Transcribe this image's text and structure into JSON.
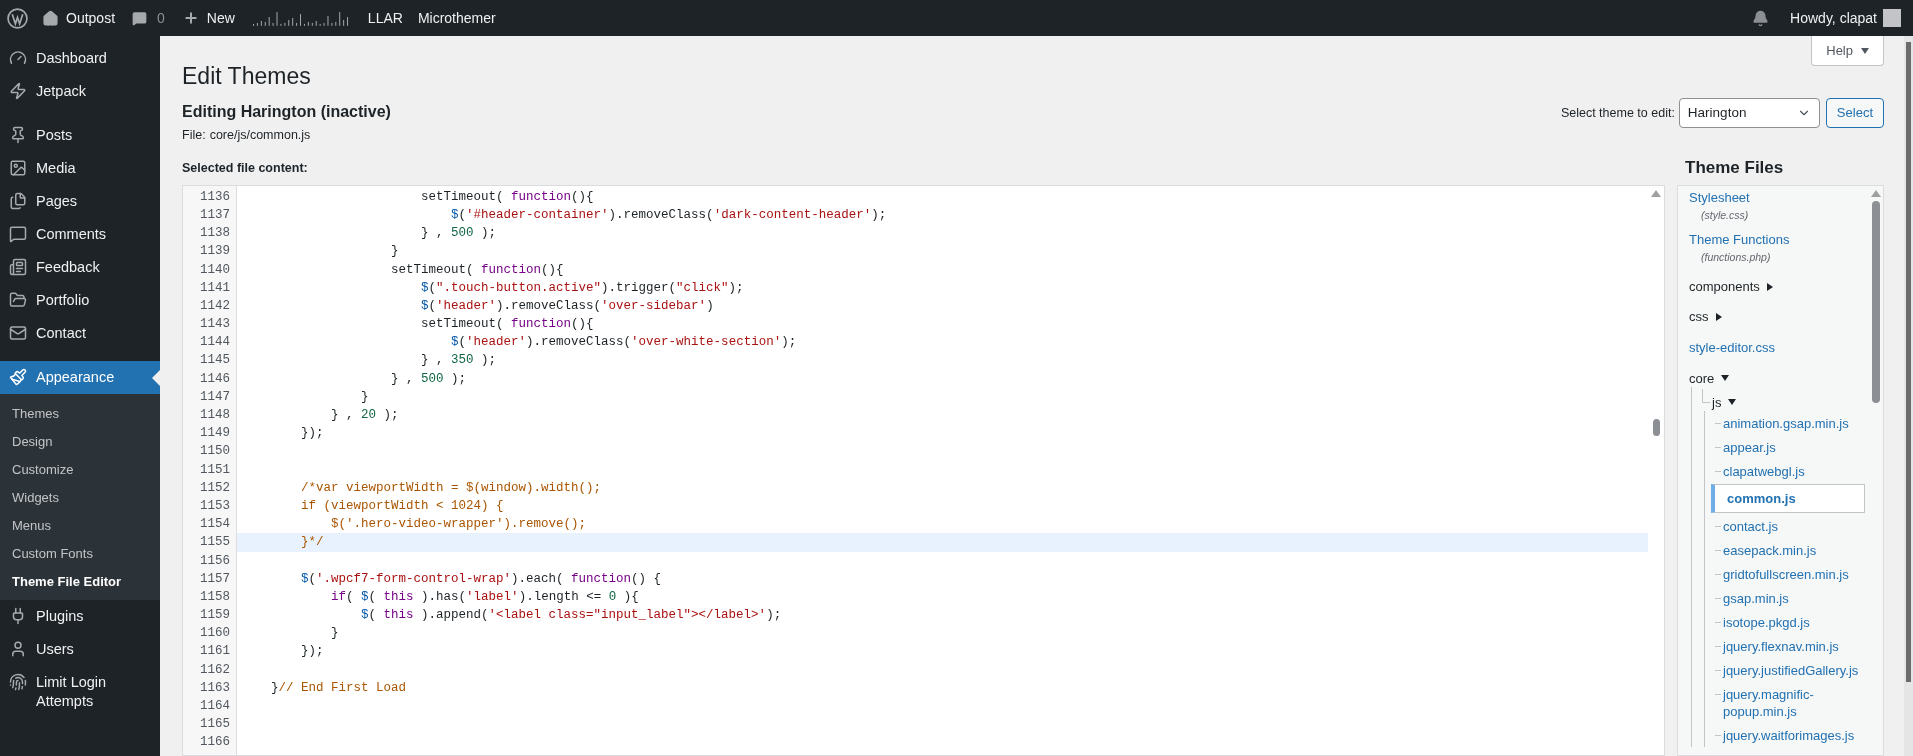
{
  "admin_bar": {
    "site": "Outpost",
    "comments": "0",
    "new": "New",
    "links": [
      "LLAR",
      "Microthemer"
    ],
    "greeting": "Howdy, clapat"
  },
  "sidebar": {
    "items": [
      {
        "label": "Dashboard",
        "selected": false
      },
      {
        "label": "Jetpack",
        "selected": false
      },
      {
        "label": "Posts",
        "selected": false
      },
      {
        "label": "Media",
        "selected": false
      },
      {
        "label": "Pages",
        "selected": false
      },
      {
        "label": "Comments",
        "selected": false
      },
      {
        "label": "Feedback",
        "selected": false
      },
      {
        "label": "Portfolio",
        "selected": false
      },
      {
        "label": "Contact",
        "selected": false
      },
      {
        "label": "Appearance",
        "selected": true,
        "children": [
          {
            "label": "Themes",
            "selected": false
          },
          {
            "label": "Design",
            "selected": false
          },
          {
            "label": "Customize",
            "selected": false
          },
          {
            "label": "Widgets",
            "selected": false
          },
          {
            "label": "Menus",
            "selected": false
          },
          {
            "label": "Custom Fonts",
            "selected": false
          },
          {
            "label": "Theme File Editor",
            "selected": true
          }
        ]
      },
      {
        "label": "Plugins",
        "selected": false
      },
      {
        "label": "Users",
        "selected": false
      },
      {
        "label": "Limit Login Attempts",
        "selected": false
      }
    ]
  },
  "help_button": "Help",
  "page": {
    "title": "Edit Themes",
    "subtitle": "Editing Harington (inactive)",
    "file_label": "File:",
    "file_path": "core/js/common.js",
    "content_label": "Selected file content:"
  },
  "theme_select": {
    "label": "Select theme to edit:",
    "value": "Harington",
    "button": "Select"
  },
  "editor": {
    "lines": [
      {
        "number": "1136",
        "highlighted": false,
        "segments": [
          {
            "kind": "plain",
            "text": "                        setTimeout( "
          },
          {
            "kind": "keyword",
            "text": "function"
          },
          {
            "kind": "plain",
            "text": "(){"
          }
        ]
      },
      {
        "number": "1137",
        "highlighted": false,
        "segments": [
          {
            "kind": "dollar",
            "text": "                            $"
          },
          {
            "kind": "plain",
            "text": "("
          },
          {
            "kind": "string",
            "text": "'#header-container'"
          },
          {
            "kind": "plain",
            "text": ").removeClass("
          },
          {
            "kind": "string",
            "text": "'dark-content-header'"
          },
          {
            "kind": "plain",
            "text": ");"
          }
        ]
      },
      {
        "number": "1138",
        "highlighted": false,
        "segments": [
          {
            "kind": "plain",
            "text": "                        } , "
          },
          {
            "kind": "number",
            "text": "500"
          },
          {
            "kind": "plain",
            "text": " );"
          }
        ]
      },
      {
        "number": "1139",
        "highlighted": false,
        "segments": [
          {
            "kind": "plain",
            "text": "                    }"
          }
        ]
      },
      {
        "number": "1140",
        "highlighted": false,
        "segments": [
          {
            "kind": "plain",
            "text": "                    setTimeout( "
          },
          {
            "kind": "keyword",
            "text": "function"
          },
          {
            "kind": "plain",
            "text": "(){"
          }
        ]
      },
      {
        "number": "1141",
        "highlighted": false,
        "segments": [
          {
            "kind": "dollar",
            "text": "                        $"
          },
          {
            "kind": "plain",
            "text": "("
          },
          {
            "kind": "string",
            "text": "\".touch-button.active\""
          },
          {
            "kind": "plain",
            "text": ").trigger("
          },
          {
            "kind": "string",
            "text": "\"click\""
          },
          {
            "kind": "plain",
            "text": ");"
          }
        ]
      },
      {
        "number": "1142",
        "highlighted": false,
        "segments": [
          {
            "kind": "dollar",
            "text": "                        $"
          },
          {
            "kind": "plain",
            "text": "("
          },
          {
            "kind": "string",
            "text": "'header'"
          },
          {
            "kind": "plain",
            "text": ").removeClass("
          },
          {
            "kind": "string",
            "text": "'over-sidebar'"
          },
          {
            "kind": "plain",
            "text": ")"
          }
        ]
      },
      {
        "number": "1143",
        "highlighted": false,
        "segments": [
          {
            "kind": "plain",
            "text": "                        setTimeout( "
          },
          {
            "kind": "keyword",
            "text": "function"
          },
          {
            "kind": "plain",
            "text": "(){"
          }
        ]
      },
      {
        "number": "1144",
        "highlighted": false,
        "segments": [
          {
            "kind": "dollar",
            "text": "                            $"
          },
          {
            "kind": "plain",
            "text": "("
          },
          {
            "kind": "string",
            "text": "'header'"
          },
          {
            "kind": "plain",
            "text": ").removeClass("
          },
          {
            "kind": "string",
            "text": "'over-white-section'"
          },
          {
            "kind": "plain",
            "text": ");"
          }
        ]
      },
      {
        "number": "1145",
        "highlighted": false,
        "segments": [
          {
            "kind": "plain",
            "text": "                        } , "
          },
          {
            "kind": "number",
            "text": "350"
          },
          {
            "kind": "plain",
            "text": " );"
          }
        ]
      },
      {
        "number": "1146",
        "highlighted": false,
        "segments": [
          {
            "kind": "plain",
            "text": "                    } , "
          },
          {
            "kind": "number",
            "text": "500"
          },
          {
            "kind": "plain",
            "text": " );"
          }
        ]
      },
      {
        "number": "1147",
        "highlighted": false,
        "segments": [
          {
            "kind": "plain",
            "text": "                }"
          }
        ]
      },
      {
        "number": "1148",
        "highlighted": false,
        "segments": [
          {
            "kind": "plain",
            "text": "            } , "
          },
          {
            "kind": "number",
            "text": "20"
          },
          {
            "kind": "plain",
            "text": " );"
          }
        ]
      },
      {
        "number": "1149",
        "highlighted": false,
        "segments": [
          {
            "kind": "plain",
            "text": "        });"
          }
        ]
      },
      {
        "number": "1150",
        "highlighted": false
      },
      {
        "number": "1151",
        "highlighted": false
      },
      {
        "number": "1152",
        "highlighted": false,
        "segments": [
          {
            "kind": "comment",
            "text": "        /*var viewportWidth = $(window).width();"
          }
        ]
      },
      {
        "number": "1153",
        "highlighted": false,
        "segments": [
          {
            "kind": "comment",
            "text": "        if (viewportWidth < 1024) {"
          }
        ]
      },
      {
        "number": "1154",
        "highlighted": false,
        "segments": [
          {
            "kind": "comment",
            "text": "            $('.hero-video-wrapper').remove();"
          }
        ]
      },
      {
        "number": "1155",
        "highlighted": true,
        "segments": [
          {
            "kind": "comment",
            "text": "        }*/"
          }
        ]
      },
      {
        "number": "1156",
        "highlighted": false
      },
      {
        "number": "1157",
        "highlighted": false,
        "segments": [
          {
            "kind": "dollar",
            "text": "        $"
          },
          {
            "kind": "plain",
            "text": "("
          },
          {
            "kind": "string",
            "text": "'.wpcf7-form-control-wrap'"
          },
          {
            "kind": "plain",
            "text": ").each( "
          },
          {
            "kind": "keyword",
            "text": "function"
          },
          {
            "kind": "plain",
            "text": "() {"
          }
        ]
      },
      {
        "number": "1158",
        "highlighted": false,
        "segments": [
          {
            "kind": "keyword",
            "text": "            if"
          },
          {
            "kind": "plain",
            "text": "( "
          },
          {
            "kind": "dollar",
            "text": "$"
          },
          {
            "kind": "plain",
            "text": "( "
          },
          {
            "kind": "keyword",
            "text": "this"
          },
          {
            "kind": "plain",
            "text": " ).has("
          },
          {
            "kind": "string",
            "text": "'label'"
          },
          {
            "kind": "plain",
            "text": ").length <= "
          },
          {
            "kind": "number",
            "text": "0"
          },
          {
            "kind": "plain",
            "text": " ){"
          }
        ]
      },
      {
        "number": "1159",
        "highlighted": false,
        "segments": [
          {
            "kind": "dollar",
            "text": "                $"
          },
          {
            "kind": "plain",
            "text": "( "
          },
          {
            "kind": "keyword",
            "text": "this"
          },
          {
            "kind": "plain",
            "text": " ).append("
          },
          {
            "kind": "string",
            "text": "'<label class=\"input_label\"></label>'"
          },
          {
            "kind": "plain",
            "text": ");"
          }
        ]
      },
      {
        "number": "1160",
        "highlighted": false,
        "segments": [
          {
            "kind": "plain",
            "text": "            }"
          }
        ]
      },
      {
        "number": "1161",
        "highlighted": false,
        "segments": [
          {
            "kind": "plain",
            "text": "        });"
          }
        ]
      },
      {
        "number": "1162",
        "highlighted": false
      },
      {
        "number": "1163",
        "highlighted": false,
        "segments": [
          {
            "kind": "plain",
            "text": "    }"
          },
          {
            "kind": "comment",
            "text": "// End First Load"
          }
        ]
      },
      {
        "number": "1164",
        "highlighted": false
      },
      {
        "number": "1165",
        "highlighted": false
      },
      {
        "number": "1166",
        "highlighted": false
      }
    ]
  },
  "theme_files": {
    "title": "Theme Files",
    "items": [
      {
        "kind": "file",
        "label": "Stylesheet",
        "note": "(style.css)",
        "selected": false
      },
      {
        "kind": "file",
        "label": "Theme Functions",
        "note": "(functions.php)",
        "selected": false
      },
      {
        "kind": "folder",
        "label": "components",
        "expanded": false
      },
      {
        "kind": "folder",
        "label": "css",
        "expanded": false
      },
      {
        "kind": "file",
        "label": "style-editor.css",
        "selected": false
      },
      {
        "kind": "folder",
        "label": "core",
        "expanded": true,
        "children": [
          {
            "kind": "folder",
            "label": "js",
            "expanded": true,
            "children": [
              {
                "kind": "file",
                "label": "animation.gsap.min.js",
                "selected": false
              },
              {
                "kind": "file",
                "label": "appear.js",
                "selected": false
              },
              {
                "kind": "file",
                "label": "clapatwebgl.js",
                "selected": false
              },
              {
                "kind": "file",
                "label": "common.js",
                "selected": true
              },
              {
                "kind": "file",
                "label": "contact.js",
                "selected": false
              },
              {
                "kind": "file",
                "label": "easepack.min.js",
                "selected": false
              },
              {
                "kind": "file",
                "label": "gridtofullscreen.min.js",
                "selected": false
              },
              {
                "kind": "file",
                "label": "gsap.min.js",
                "selected": false
              },
              {
                "kind": "file",
                "label": "isotope.pkgd.js",
                "selected": false
              },
              {
                "kind": "file",
                "label": "jquery.flexnav.min.js",
                "selected": false
              },
              {
                "kind": "file",
                "label": "jquery.justifiedGallery.js",
                "selected": false
              },
              {
                "kind": "file",
                "label": "jquery.magnific-popup.min.js",
                "selected": false
              },
              {
                "kind": "file",
                "label": "jquery.waitforimages.js",
                "selected": false
              }
            ]
          }
        ]
      }
    ]
  }
}
